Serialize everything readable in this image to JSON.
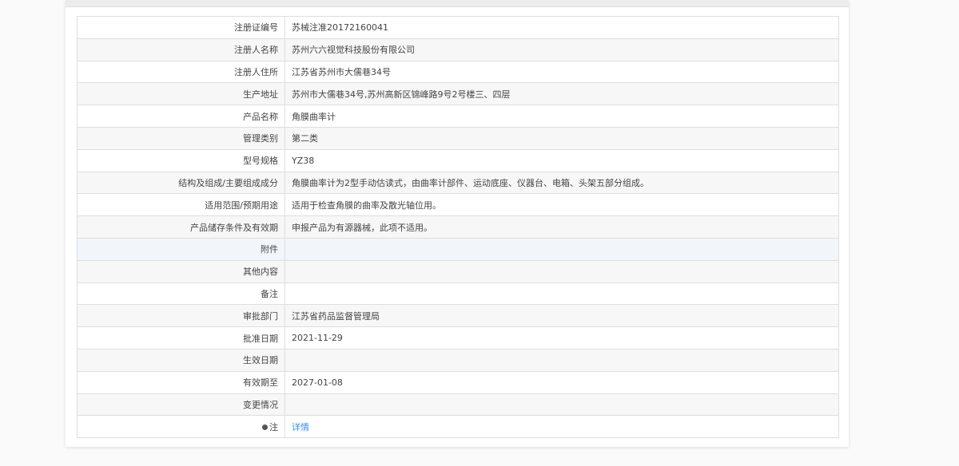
{
  "rows": [
    {
      "label": "注册证编号",
      "value": "苏械注准20172160041"
    },
    {
      "label": "注册人名称",
      "value": "苏州六六视觉科技股份有限公司"
    },
    {
      "label": "注册人住所",
      "value": "江苏省苏州市大儒巷34号"
    },
    {
      "label": "生产地址",
      "value": "苏州市大儒巷34号,苏州高新区锦峰路9号2号楼三、四层"
    },
    {
      "label": "产品名称",
      "value": "角膜曲率计"
    },
    {
      "label": "管理类别",
      "value": "第二类"
    },
    {
      "label": "型号规格",
      "value": "YZ38"
    },
    {
      "label": "结构及组成/主要组成成分",
      "value": "角膜曲率计为2型手动估读式，由曲率计部件、运动底座、仪器台、电箱、头架五部分组成。"
    },
    {
      "label": "适用范围/预期用途",
      "value": "适用于检查角膜的曲率及散光轴位用。"
    },
    {
      "label": "产品储存条件及有效期",
      "value": "申报产品为有源器械，此项不适用。"
    },
    {
      "label": "附件",
      "value": ""
    },
    {
      "label": "其他内容",
      "value": ""
    },
    {
      "label": "备注",
      "value": ""
    },
    {
      "label": "审批部门",
      "value": "江苏省药品监督管理局"
    },
    {
      "label": "批准日期",
      "value": "2021-11-29"
    },
    {
      "label": "生效日期",
      "value": ""
    },
    {
      "label": "有效期至",
      "value": "2027-01-08"
    },
    {
      "label": "变更情况",
      "value": ""
    }
  ],
  "note": {
    "label": "注",
    "icon": "pin-icon",
    "link": "详情",
    "link_color": "#3a8ee6"
  }
}
